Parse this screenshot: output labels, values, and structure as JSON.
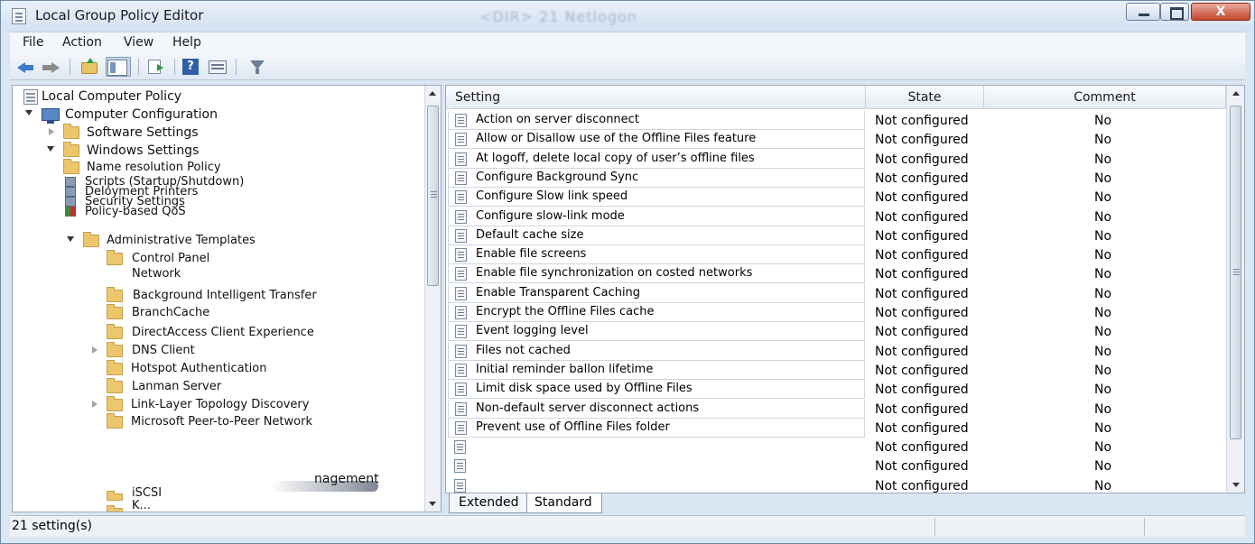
{
  "window": {
    "title": "Local Group Policy Editor",
    "ghost_title": "<DIR>    21    Netlogon",
    "close_label": "X"
  },
  "menu": [
    "File",
    "Action",
    "View",
    "Help"
  ],
  "toolbar": {
    "icons": [
      "back-arrow-icon",
      "forward-arrow-icon",
      "folder-up-icon",
      "show-hide-tree-icon",
      "export-list-icon",
      "help-icon",
      "properties-icon",
      "filter-icon"
    ],
    "help_glyph": "?"
  },
  "tree": {
    "root": "Local Computer Policy",
    "computer_configuration": "Computer Configuration",
    "software_settings": "Software Settings",
    "windows_settings": "Windows Settings",
    "name_resolution": "Name resolution Policy",
    "scripts": "Scripts (Startup/Shutdown)",
    "deployed_printers": "Deloyment Printers",
    "security_settings": "Security Settings",
    "qos": "Policy-based QoS",
    "admin_templates": "Administrative Templates",
    "admin_children": [
      "Control Panel",
      "Network",
      "Background Intelligent Transfer",
      "BranchCache",
      "DirectAccess Client Experience",
      "DNS Client",
      "Hotspot Authentication",
      "Lanman Server",
      "Link-Layer Topology Discovery",
      "Microsoft Peer-to-Peer Network"
    ],
    "partial_1": "nagement",
    "partial_2": "iSCSI",
    "partial_3": "K..."
  },
  "table": {
    "headers": {
      "setting": "Setting",
      "state": "State",
      "comment": "Comment"
    },
    "rows": [
      {
        "setting": "Action on server disconnect",
        "state": "Not configured",
        "comment": "No"
      },
      {
        "setting": "Allow or Disallow use of the Offline Files feature",
        "state": "Not configured",
        "comment": "No"
      },
      {
        "setting": "At logoff, delete local copy of user’s offline files",
        "state": "Not configured",
        "comment": "No"
      },
      {
        "setting": "Configure Background Sync",
        "state": "Not configured",
        "comment": "No"
      },
      {
        "setting": "Configure Slow link speed",
        "state": "Not configured",
        "comment": "No"
      },
      {
        "setting": "Configure slow-link mode",
        "state": "Not configured",
        "comment": "No"
      },
      {
        "setting": "Default cache size",
        "state": "Not configured",
        "comment": "No"
      },
      {
        "setting": "Enable file screens",
        "state": "Not configured",
        "comment": "No"
      },
      {
        "setting": "Enable file synchronization on costed networks",
        "state": "Not configured",
        "comment": "No"
      },
      {
        "setting": "Enable Transparent Caching",
        "state": "Not configured",
        "comment": "No"
      },
      {
        "setting": "Encrypt the Offline Files cache",
        "state": "Not configured",
        "comment": "No"
      },
      {
        "setting": "Event logging level",
        "state": "Not configured",
        "comment": "No"
      },
      {
        "setting": "Files not cached",
        "state": "Not configured",
        "comment": "No"
      },
      {
        "setting": "Initial reminder ballon lifetime",
        "state": "Not configured",
        "comment": "No"
      },
      {
        "setting": "Limit disk space used by Offline Files",
        "state": "Not configured",
        "comment": "No"
      },
      {
        "setting": "Non-default server disconnect actions",
        "state": "Not configured",
        "comment": "No"
      },
      {
        "setting": "Prevent use of Offline Files folder",
        "state": "Not configured",
        "comment": "No"
      },
      {
        "setting": "",
        "state": "Not configured",
        "comment": "No"
      },
      {
        "setting": "",
        "state": "Not configured",
        "comment": "No"
      },
      {
        "setting": "",
        "state": "Not configured",
        "comment": "No"
      }
    ]
  },
  "tabs": [
    "Extended",
    "Standard"
  ],
  "status": {
    "text": "21 setting(s)"
  },
  "colors": {
    "chrome": "#dbe6f3",
    "folder": "#ecc66c",
    "close": "#c4452c"
  }
}
